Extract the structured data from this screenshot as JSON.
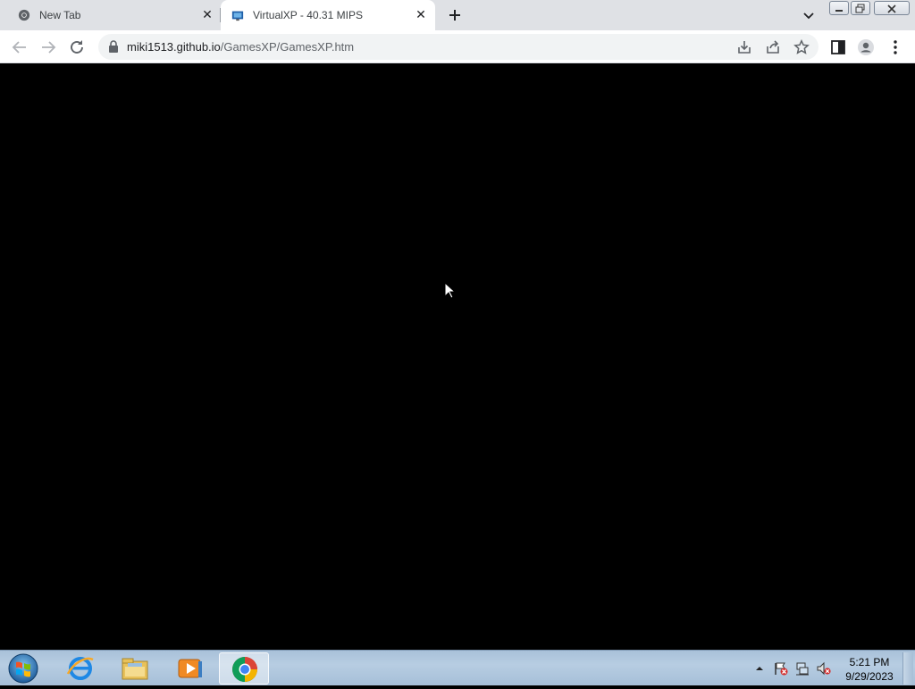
{
  "browser": {
    "tabs": [
      {
        "title": "New Tab",
        "active": false,
        "icon": "chrome-icon"
      },
      {
        "title": "VirtualXP - 40.31 MIPS",
        "active": true,
        "icon": "virtualxp-icon"
      }
    ],
    "url_host": "miki1513.github.io",
    "url_path": "/GamesXP/GamesXP.htm"
  },
  "taskbar": {
    "apps": [
      "internet-explorer-icon",
      "file-explorer-icon",
      "media-player-icon",
      "chrome-icon"
    ],
    "clock_time": "5:21 PM",
    "clock_date": "9/29/2023"
  },
  "colors": {
    "page_background": "#000000",
    "tabstrip": "#dfe1e5",
    "taskbar": "#a9c1d9"
  }
}
